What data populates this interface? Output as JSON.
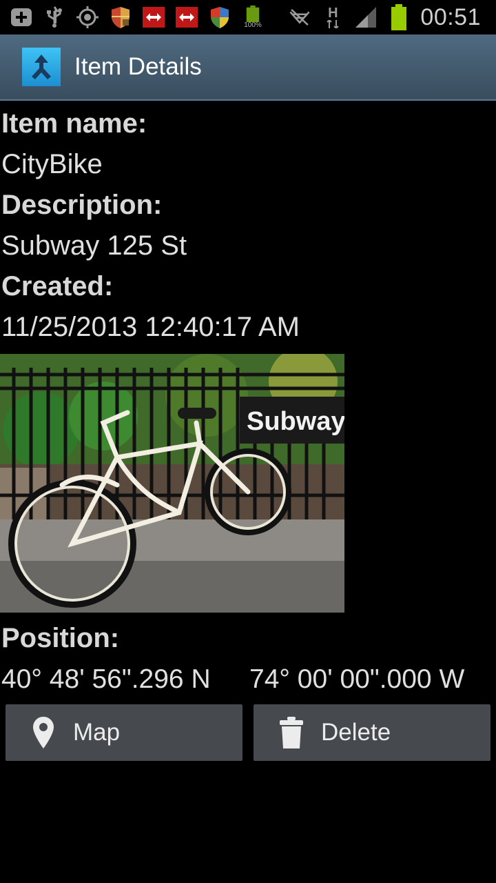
{
  "statusbar": {
    "left_icons": [
      "add-icon",
      "usb-icon",
      "gps-icon",
      "shield-icon",
      "transit-icon",
      "transit-icon",
      "shield-icon",
      "battery-full-icon"
    ],
    "battery_small_label": "100%",
    "network_label": "H",
    "time": "00:51"
  },
  "actionbar": {
    "title": "Item Details"
  },
  "details": {
    "name_label": "Item name:",
    "name_value": "CityBike",
    "description_label": "Description:",
    "description_value": "Subway 125 St",
    "created_label": "Created:",
    "created_value": "11/25/2013 12:40:17 AM"
  },
  "photo": {
    "sign_text": "Subway"
  },
  "position": {
    "label": "Position:",
    "latitude": "40° 48' 56\".296 N",
    "longitude": "74° 00' 00\".000 W"
  },
  "buttons": {
    "map_label": "Map",
    "delete_label": "Delete"
  },
  "colors": {
    "actionbar": "#455c6f",
    "button": "#464a4e",
    "battery": "#99cc00"
  }
}
